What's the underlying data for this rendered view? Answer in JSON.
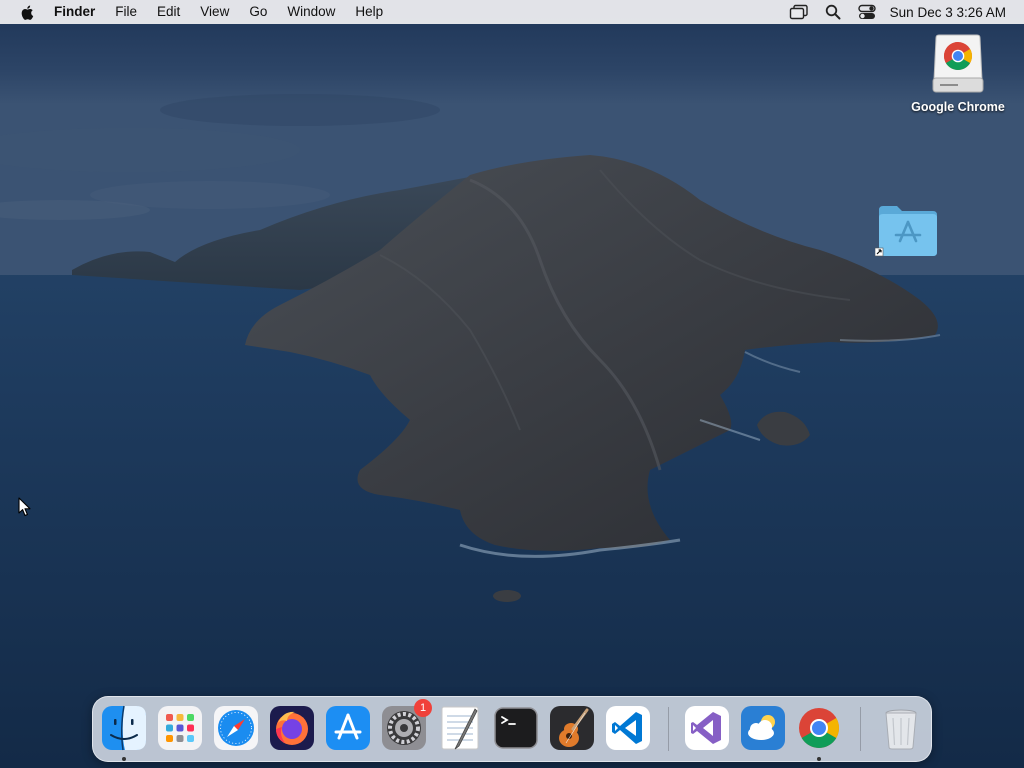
{
  "menubar": {
    "app_name": "Finder",
    "menus": [
      "File",
      "Edit",
      "View",
      "Go",
      "Window",
      "Help"
    ],
    "clock": "Sun Dec 3  3:26 AM"
  },
  "desktop": {
    "icons": [
      {
        "label": "Google Chrome",
        "icon": "chrome-drive-icon"
      },
      {
        "label": "",
        "icon": "applications-folder-alias-icon"
      }
    ]
  },
  "dock": {
    "apps": [
      {
        "name": "Finder",
        "icon": "finder-icon",
        "running": true
      },
      {
        "name": "Launchpad",
        "icon": "launchpad-icon",
        "running": false
      },
      {
        "name": "Safari",
        "icon": "safari-icon",
        "running": false
      },
      {
        "name": "Firefox",
        "icon": "firefox-icon",
        "running": false
      },
      {
        "name": "App Store",
        "icon": "app-store-icon",
        "running": false
      },
      {
        "name": "System Preferences",
        "icon": "system-preferences-icon",
        "running": false,
        "badge": "1"
      },
      {
        "name": "TextEdit",
        "icon": "textedit-icon",
        "running": false
      },
      {
        "name": "Terminal",
        "icon": "terminal-icon",
        "running": false
      },
      {
        "name": "GarageBand",
        "icon": "garageband-icon",
        "running": false
      },
      {
        "name": "Visual Studio Code",
        "icon": "vscode-icon",
        "running": false
      },
      {
        "name": "Visual Studio",
        "icon": "visual-studio-icon",
        "running": false
      },
      {
        "name": "Weather",
        "icon": "weather-icon",
        "running": false
      },
      {
        "name": "Google Chrome",
        "icon": "chrome-icon",
        "running": true
      },
      {
        "name": "Trash",
        "icon": "trash-icon",
        "running": false
      }
    ]
  },
  "colors": {
    "menubar_bg": "#e8e9ec",
    "badge_red": "#f0413a",
    "folder_blue": "#5fb9ea"
  }
}
